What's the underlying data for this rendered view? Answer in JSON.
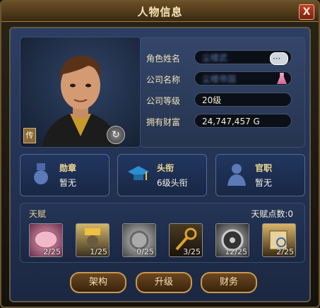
{
  "window": {
    "title": "人物信息",
    "close_label": "X"
  },
  "portrait": {
    "tag": "传",
    "refresh_symbol": "↻"
  },
  "info": {
    "name_label": "角色姓名",
    "name_value": "尘楼武",
    "company_label": "公司名称",
    "company_value": "尘楼帝国",
    "level_label": "公司等级",
    "level_value": "20级",
    "wealth_label": "拥有财富",
    "wealth_value": "24,747,457 G"
  },
  "cards": [
    {
      "title": "勋章",
      "value": "暂无",
      "icon": "medal-icon"
    },
    {
      "title": "头衔",
      "value": "6级头衔",
      "icon": "graduation-cap-icon"
    },
    {
      "title": "官职",
      "value": "暂无",
      "icon": "person-icon"
    }
  ],
  "talent": {
    "title": "天赋",
    "points_label": "天赋点数:",
    "points_value": "0",
    "skills": [
      {
        "count": "2/25",
        "icon": "brain-icon"
      },
      {
        "count": "1/25",
        "icon": "worker-icon"
      },
      {
        "count": "0/25",
        "icon": "gear-icon"
      },
      {
        "count": "3/25",
        "icon": "key-icon"
      },
      {
        "count": "12/25",
        "icon": "wheel-icon"
      },
      {
        "count": "2/25",
        "icon": "book-icon"
      }
    ]
  },
  "buttons": {
    "structure": "架构",
    "upgrade": "升级",
    "finance": "财务"
  }
}
